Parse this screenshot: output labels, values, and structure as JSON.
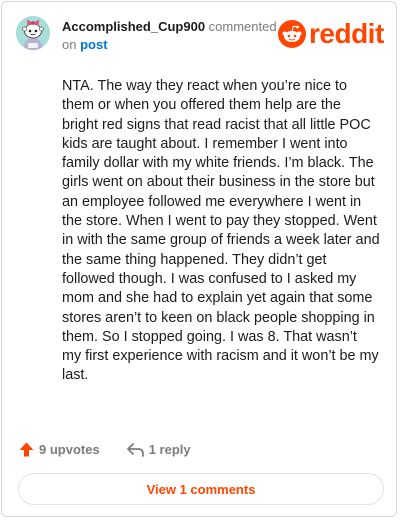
{
  "comment": {
    "username": "Accomplished_Cup900",
    "action_text": "commented",
    "on_text": "on",
    "post_link": "post",
    "body": "NTA. The way they react when you’re nice to them or when you offered them help are the bright red signs that read racist that all little POC kids are taught about. I remember I went into family dollar with my white friends. I’m black. The girls went on about their business in the store but an employee followed me everywhere I went in the store. When I went to pay they stopped. Went in with the same group of friends a week later and the same thing happened. They didn’t get followed though. I was confused to I asked my mom and she had to explain yet again that some stores aren’t to keen on black people shopping in them. So I stopped going. I was 8. That wasn’t my first experience with racism and it won’t be my last.",
    "upvotes": "9 upvotes",
    "replies": "1 reply",
    "view_button": "View 1 comments"
  },
  "brand": {
    "logo_text": "reddit",
    "logo_icon": "reddit-snoo-icon",
    "brand_color": "#ff4500",
    "link_color": "#0079d3"
  },
  "icons": {
    "avatar": "snoo-avatar-with-bow",
    "upvote": "upvote-arrow-icon",
    "reply": "reply-arrow-icon"
  }
}
